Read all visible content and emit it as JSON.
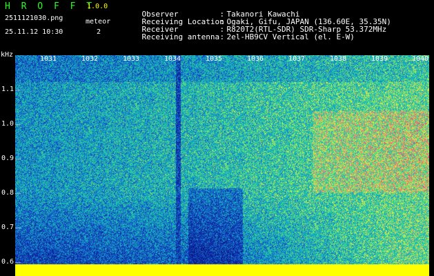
{
  "header": {
    "app_name": "H R O F F T",
    "version": "1.0.0",
    "file_name": "2511121030.png",
    "detection_label": "meteor",
    "date_time": "25.11.12 10:30",
    "detection_count": "2"
  },
  "info": [
    {
      "label": "Observer",
      "value": "Takanori Kawachi"
    },
    {
      "label": "Receiving Location",
      "value": "Ogaki, Gifu, JAPAN (136.60E, 35.35N)"
    },
    {
      "label": "Receiver",
      "value": "R820T2(RTL-SDR) SDR-Sharp 53.372MHz"
    },
    {
      "label": "Receiving antenna",
      "value": "2el-HB9CV Vertical (el. E-W)"
    }
  ],
  "info_separator": ":",
  "axis": {
    "y_unit": "kHz",
    "y_ticks": [
      "1.1",
      "1.0",
      "0.9",
      "0.8",
      "0.7",
      "0.6"
    ],
    "x_ticks": [
      "1031",
      "1032",
      "1033",
      "1034",
      "1035",
      "1036",
      "1037",
      "1038",
      "1039",
      "1040"
    ]
  },
  "colors": {
    "low": "#0a1e9c",
    "mid": "#13b8c8",
    "high": "#e5ff3a",
    "peak": "#ff2a6a",
    "baseline": "#ffff00",
    "title": "#22ff22"
  }
}
